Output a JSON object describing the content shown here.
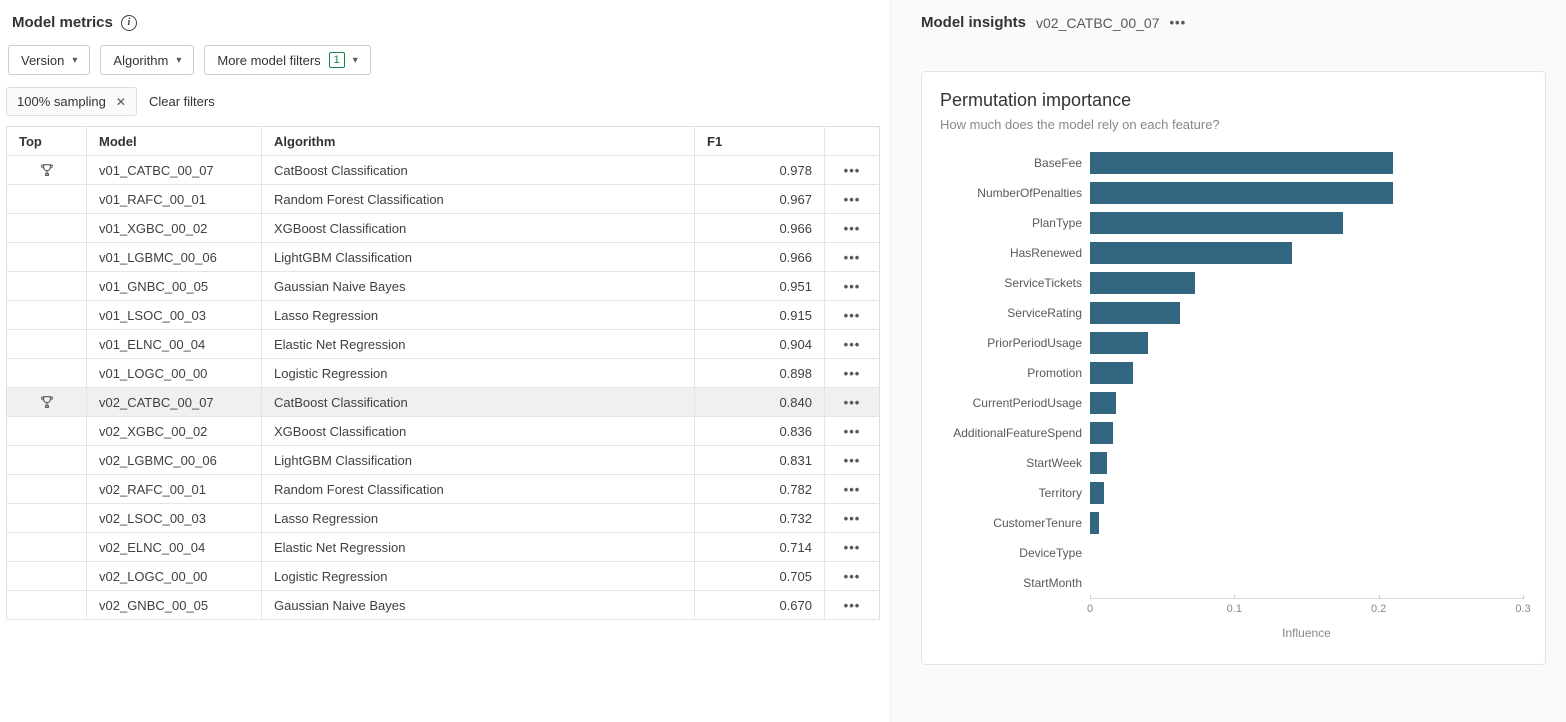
{
  "metrics": {
    "title": "Model metrics",
    "filters": {
      "version": "Version",
      "algorithm": "Algorithm",
      "more": "More model filters",
      "more_count": "1"
    },
    "chips": {
      "sampling": "100% sampling"
    },
    "clear": "Clear filters",
    "columns": {
      "top": "Top",
      "model": "Model",
      "algorithm": "Algorithm",
      "f1": "F1"
    },
    "rows": [
      {
        "top": true,
        "model": "v01_CATBC_00_07",
        "algorithm": "CatBoost Classification",
        "f1": "0.978",
        "selected": false
      },
      {
        "top": false,
        "model": "v01_RAFC_00_01",
        "algorithm": "Random Forest Classification",
        "f1": "0.967",
        "selected": false
      },
      {
        "top": false,
        "model": "v01_XGBC_00_02",
        "algorithm": "XGBoost Classification",
        "f1": "0.966",
        "selected": false
      },
      {
        "top": false,
        "model": "v01_LGBMC_00_06",
        "algorithm": "LightGBM Classification",
        "f1": "0.966",
        "selected": false
      },
      {
        "top": false,
        "model": "v01_GNBC_00_05",
        "algorithm": "Gaussian Naive Bayes",
        "f1": "0.951",
        "selected": false
      },
      {
        "top": false,
        "model": "v01_LSOC_00_03",
        "algorithm": "Lasso Regression",
        "f1": "0.915",
        "selected": false
      },
      {
        "top": false,
        "model": "v01_ELNC_00_04",
        "algorithm": "Elastic Net Regression",
        "f1": "0.904",
        "selected": false
      },
      {
        "top": false,
        "model": "v01_LOGC_00_00",
        "algorithm": "Logistic Regression",
        "f1": "0.898",
        "selected": false
      },
      {
        "top": true,
        "model": "v02_CATBC_00_07",
        "algorithm": "CatBoost Classification",
        "f1": "0.840",
        "selected": true
      },
      {
        "top": false,
        "model": "v02_XGBC_00_02",
        "algorithm": "XGBoost Classification",
        "f1": "0.836",
        "selected": false
      },
      {
        "top": false,
        "model": "v02_LGBMC_00_06",
        "algorithm": "LightGBM Classification",
        "f1": "0.831",
        "selected": false
      },
      {
        "top": false,
        "model": "v02_RAFC_00_01",
        "algorithm": "Random Forest Classification",
        "f1": "0.782",
        "selected": false
      },
      {
        "top": false,
        "model": "v02_LSOC_00_03",
        "algorithm": "Lasso Regression",
        "f1": "0.732",
        "selected": false
      },
      {
        "top": false,
        "model": "v02_ELNC_00_04",
        "algorithm": "Elastic Net Regression",
        "f1": "0.714",
        "selected": false
      },
      {
        "top": false,
        "model": "v02_LOGC_00_00",
        "algorithm": "Logistic Regression",
        "f1": "0.705",
        "selected": false
      },
      {
        "top": false,
        "model": "v02_GNBC_00_05",
        "algorithm": "Gaussian Naive Bayes",
        "f1": "0.670",
        "selected": false
      }
    ]
  },
  "insights": {
    "title": "Model insights",
    "model": "v02_CATBC_00_07",
    "card_title": "Permutation importance",
    "card_sub": "How much does the model rely on each feature?",
    "xlabel": "Influence"
  },
  "chart_data": {
    "type": "bar",
    "orientation": "horizontal",
    "title": "Permutation importance",
    "subtitle": "How much does the model rely on each feature?",
    "xlabel": "Influence",
    "xlim": [
      0,
      0.3
    ],
    "xticks": [
      0,
      0.1,
      0.2,
      0.3
    ],
    "categories": [
      "BaseFee",
      "NumberOfPenalties",
      "PlanType",
      "HasRenewed",
      "ServiceTickets",
      "ServiceRating",
      "PriorPeriodUsage",
      "Promotion",
      "CurrentPeriodUsage",
      "AdditionalFeatureSpend",
      "StartWeek",
      "Territory",
      "CustomerTenure",
      "DeviceType",
      "StartMonth"
    ],
    "values": [
      0.21,
      0.21,
      0.175,
      0.14,
      0.073,
      0.062,
      0.04,
      0.03,
      0.018,
      0.016,
      0.012,
      0.01,
      0.006,
      0.0,
      0.0
    ]
  }
}
